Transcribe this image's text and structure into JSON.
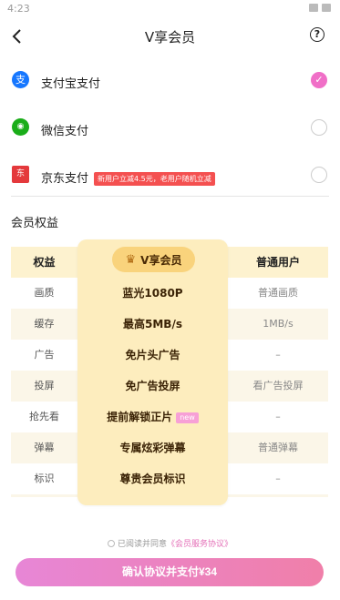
{
  "status_bar": {
    "time": "4:23"
  },
  "header": {
    "title": "V享会员",
    "help_glyph": "?"
  },
  "payment": {
    "methods": [
      {
        "label": "支付宝支付",
        "icon": "alipay-icon",
        "color": "#1677ff",
        "glyph": "支",
        "selected": true
      },
      {
        "label": "微信支付",
        "icon": "wechat-pay-icon",
        "color": "#1aad19",
        "glyph": "◉",
        "selected": false
      },
      {
        "label": "京东支付",
        "icon": "jd-pay-icon",
        "color": "#e4393c",
        "glyph": "东",
        "selected": false,
        "promo": "新用户立减4.5元，老用户随机立减"
      }
    ]
  },
  "benefits": {
    "section_title": "会员权益",
    "columns": {
      "benefit": "权益",
      "vip": "V享会员",
      "normal": "普通用户"
    },
    "rows": [
      {
        "benefit": "画质",
        "vip": "蓝光1080P",
        "normal": "普通画质"
      },
      {
        "benefit": "缓存",
        "vip": "最高5MB/s",
        "normal": "1MB/s"
      },
      {
        "benefit": "广告",
        "vip": "免片头广告",
        "normal": "–"
      },
      {
        "benefit": "投屏",
        "vip": "免广告投屏",
        "normal": "看广告投屏"
      },
      {
        "benefit": "抢先看",
        "vip": "提前解锁正片",
        "vip_badge": "new",
        "normal": "–"
      },
      {
        "benefit": "弹幕",
        "vip": "专属炫彩弹幕",
        "normal": "普通弹幕"
      },
      {
        "benefit": "标识",
        "vip": "尊贵会员标识",
        "normal": "–"
      }
    ]
  },
  "footer": {
    "agree_prefix": "已阅读并同意",
    "agree_link": "《会员服务协议》",
    "confirm_label": "确认协议并支付¥34"
  },
  "colors": {
    "accent_pink": "#f06fc7",
    "vip_gold": "#fdedbe",
    "promo_red": "#f45050"
  }
}
